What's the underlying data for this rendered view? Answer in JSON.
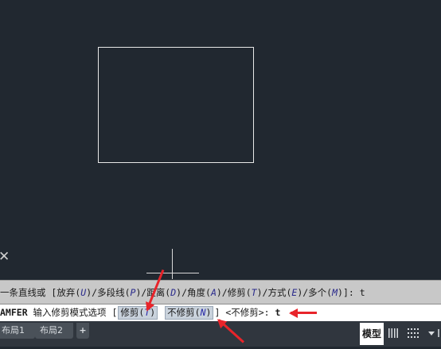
{
  "canvas": {
    "close_glyph": "✕"
  },
  "command_history": {
    "prefix": "一条直线或 [放弃(",
    "k1": "U",
    "t1": ")/多段线(",
    "k2": "P",
    "t2": ")/距离(",
    "k3": "D",
    "t3": ")/角度(",
    "k4": "A",
    "t4": ")/修剪(",
    "k5": "T",
    "t5": ")/方式(",
    "k6": "E",
    "t6": ")/多个(",
    "k7": "M",
    "t7": ")]:  t"
  },
  "command_line": {
    "command_name": "AMFER",
    "prompt": " 输入修剪模式选项 [",
    "option1_label": "修剪(",
    "option1_key": "T",
    "option1_close": ")",
    "option2_label": "不修剪(",
    "option2_key": "N",
    "option2_close": ")",
    "suffix": "] <不修剪>: ",
    "input_value": "t"
  },
  "layout_tabs": [
    {
      "label": "布局1"
    },
    {
      "label": "布局2"
    }
  ],
  "add_tab_glyph": "+",
  "status_bar": {
    "model_label": "模型",
    "grid_icon": "grid-icon",
    "snap_icon": "snap-icon",
    "dropdown_icon": "chevron-down-icon"
  },
  "colors": {
    "canvas_bg": "#212830",
    "annotation_arrow": "#e8242a",
    "option_highlight": "#c9d2dc"
  }
}
